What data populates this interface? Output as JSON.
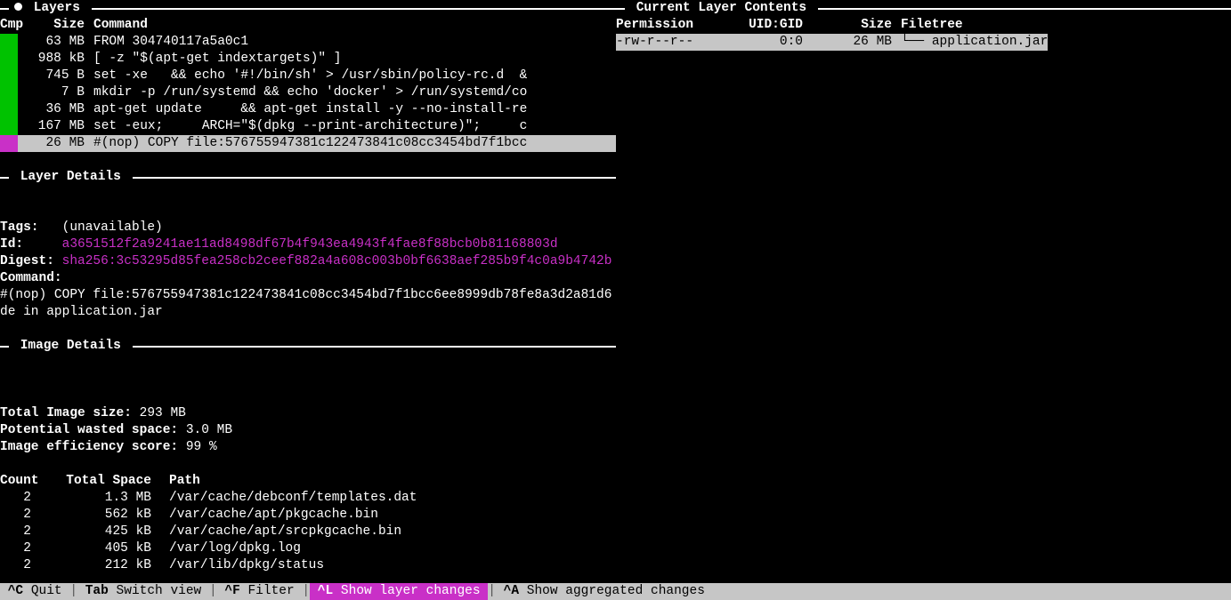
{
  "panes": {
    "layers_title": " Layers ",
    "layer_details_title": " Layer Details ",
    "image_details_title": " Image Details ",
    "contents_title": " Current Layer Contents "
  },
  "layers_header": {
    "cmp": "Cmp",
    "size": "Size",
    "command": "Command"
  },
  "layers": [
    {
      "cmp": "green",
      "size": "63 MB",
      "cmd": "FROM 304740117a5a0c1",
      "selected": false
    },
    {
      "cmp": "green",
      "size": "988 kB",
      "cmd": "[ -z \"$(apt-get indextargets)\" ]",
      "selected": false
    },
    {
      "cmp": "green",
      "size": "745 B",
      "cmd": "set -xe   && echo '#!/bin/sh' > /usr/sbin/policy-rc.d  &",
      "selected": false
    },
    {
      "cmp": "green",
      "size": "7 B",
      "cmd": "mkdir -p /run/systemd && echo 'docker' > /run/systemd/co",
      "selected": false
    },
    {
      "cmp": "green",
      "size": "36 MB",
      "cmd": "apt-get update     && apt-get install -y --no-install-re",
      "selected": false
    },
    {
      "cmp": "green",
      "size": "167 MB",
      "cmd": "set -eux;     ARCH=\"$(dpkg --print-architecture)\";     c",
      "selected": false
    },
    {
      "cmp": "magenta",
      "size": "26 MB",
      "cmd": "#(nop) COPY file:576755947381c122473841c08cc3454bd7f1bcc",
      "selected": true
    }
  ],
  "layer_details": {
    "tags_label": "Tags:   ",
    "tags_value": "(unavailable)",
    "id_label": "Id:     ",
    "id_value": "a3651512f2a9241ae11ad8498df67b4f943ea4943f4fae8f88bcb0b81168803d",
    "digest_label": "Digest: ",
    "digest_value": "sha256:3c53295d85fea258cb2ceef882a4a608c003b0bf6638aef285b9f4c0a9b4742b",
    "command_label": "Command:",
    "command_value": "#(nop) COPY file:576755947381c122473841c08cc3454bd7f1bcc6ee8999db78fe8a3d2a81d6de in application.jar "
  },
  "image_details": {
    "total_label": "Total Image size: ",
    "total_value": "293 MB",
    "wasted_label": "Potential wasted space: ",
    "wasted_value": "3.0 MB",
    "efficiency_label": "Image efficiency score: ",
    "efficiency_value": "99 %"
  },
  "waste_header": {
    "count": "Count",
    "total_space": "Total Space",
    "path": "Path"
  },
  "waste": [
    {
      "count": "2",
      "space": "1.3 MB",
      "path": "/var/cache/debconf/templates.dat"
    },
    {
      "count": "2",
      "space": "562 kB",
      "path": "/var/cache/apt/pkgcache.bin"
    },
    {
      "count": "2",
      "space": "425 kB",
      "path": "/var/cache/apt/srcpkgcache.bin"
    },
    {
      "count": "2",
      "space": "405 kB",
      "path": "/var/log/dpkg.log"
    },
    {
      "count": "2",
      "space": "212 kB",
      "path": "/var/lib/dpkg/status"
    }
  ],
  "contents_header": {
    "permission": "Permission",
    "uidgid": "UID:GID",
    "size": "Size",
    "filetree": "Filetree"
  },
  "contents_row": {
    "permission": "-rw-r--r--",
    "uidgid": "0:0",
    "size": "26 MB",
    "tree_prefix": "└── ",
    "filename": "application.jar"
  },
  "statusbar": {
    "quit_key": " ^C ",
    "quit_label": "Quit ",
    "tab_key": " Tab ",
    "tab_label": "Switch view ",
    "filter_key": " ^F ",
    "filter_label": "Filter ",
    "layer_key": " ^L ",
    "layer_label": "Show layer changes ",
    "agg_key": " ^A ",
    "agg_label": "Show aggregated changes "
  }
}
